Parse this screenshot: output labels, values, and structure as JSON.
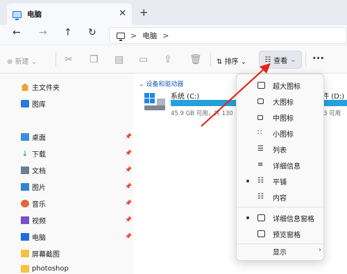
{
  "tab": {
    "title": "电脑",
    "close": "✕",
    "new_tab": "+"
  },
  "nav": {
    "back": "←",
    "forward": "→",
    "up": "↑",
    "refresh": "↻",
    "breadcrumb": [
      "电脑"
    ],
    "sep": ">"
  },
  "toolbar": {
    "new_label": "新建",
    "sort_label": "排序",
    "view_label": "查看",
    "more": "···"
  },
  "sidebar": {
    "items": [
      {
        "label": "主文件夹",
        "icon": "home-icon",
        "pinned": false
      },
      {
        "label": "图库",
        "icon": "gallery-icon",
        "pinned": false
      },
      {
        "label": "桌面",
        "icon": "desktop-icon",
        "pinned": true
      },
      {
        "label": "下载",
        "icon": "download-icon",
        "pinned": true
      },
      {
        "label": "文档",
        "icon": "document-icon",
        "pinned": true
      },
      {
        "label": "图片",
        "icon": "pictures-icon",
        "pinned": true
      },
      {
        "label": "音乐",
        "icon": "music-icon",
        "pinned": true
      },
      {
        "label": "视频",
        "icon": "video-icon",
        "pinned": true
      },
      {
        "label": "电脑",
        "icon": "computer-icon",
        "pinned": true
      },
      {
        "label": "屏幕截图",
        "icon": "folder-icon",
        "pinned": false
      },
      {
        "label": "photoshop",
        "icon": "folder-icon",
        "pinned": false
      }
    ]
  },
  "main": {
    "group_header": "设备和驱动器",
    "drive_c": {
      "name": "系统 (C:)",
      "info": "45.9 GB 可用，共 130"
    },
    "drive_d": {
      "name": "件 (D:)",
      "info": "3 可用"
    }
  },
  "view_menu": {
    "items": [
      {
        "label": "超大图标",
        "icon": "extra-large-icons-icon",
        "selected": false
      },
      {
        "label": "大图标",
        "icon": "large-icons-icon",
        "selected": false
      },
      {
        "label": "中图标",
        "icon": "medium-icons-icon",
        "selected": false
      },
      {
        "label": "小图标",
        "icon": "small-icons-icon",
        "selected": false
      },
      {
        "label": "列表",
        "icon": "list-icon",
        "selected": false
      },
      {
        "label": "详细信息",
        "icon": "details-icon",
        "selected": false
      },
      {
        "label": "平铺",
        "icon": "tiles-icon",
        "selected": true
      },
      {
        "label": "内容",
        "icon": "content-icon",
        "selected": false
      },
      {
        "label": "详细信息窗格",
        "icon": "details-pane-icon",
        "selected": true
      },
      {
        "label": "预览窗格",
        "icon": "preview-pane-icon",
        "selected": false
      }
    ],
    "show_label": "显示",
    "show_arrow": "›"
  },
  "colors": {
    "accent": "#26a0da",
    "arrow": "#e0241b",
    "link": "#1a5fb4"
  }
}
